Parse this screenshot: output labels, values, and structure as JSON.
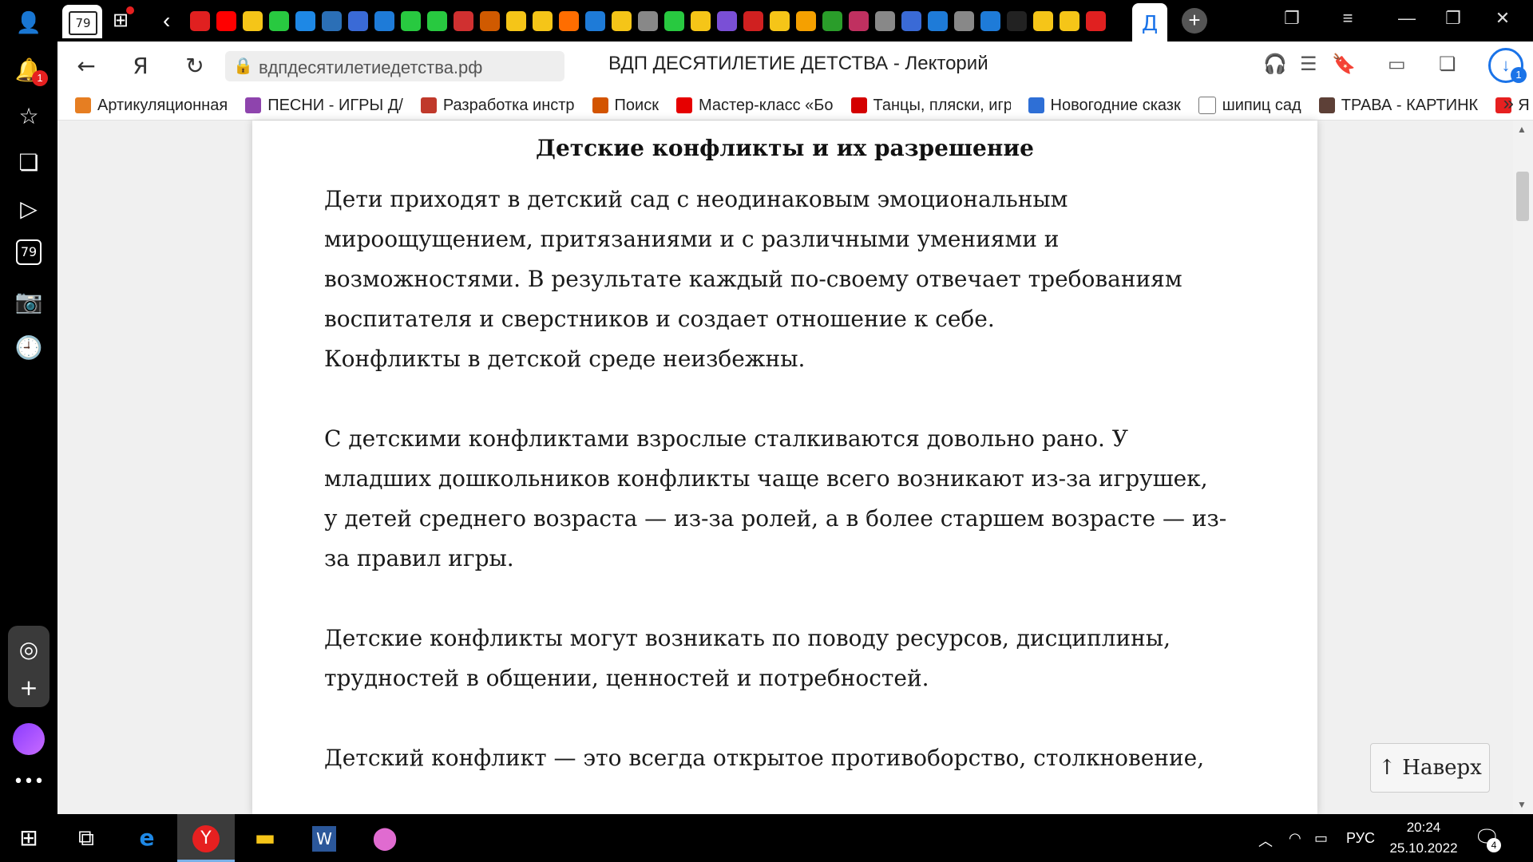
{
  "tabstrip": {
    "home_tab_count": "79",
    "active_tab_letter": "Д",
    "tab_icon_colors": [
      "#e02020",
      "#ff0000",
      "#f5c518",
      "#28c940",
      "#1e88e5",
      "#2b6fb6",
      "#3a6ad6",
      "#1e7bd8",
      "#28c940",
      "#28c940",
      "#d03030",
      "#d05a00",
      "#f5c518",
      "#f5c518",
      "#ff6d00",
      "#1e7bd8",
      "#f5c518",
      "#888888",
      "#28c940",
      "#f5c518",
      "#7a4fd6",
      "#d02020",
      "#f5c518",
      "#f5a000",
      "#2a9d2a",
      "#c03060",
      "#888888",
      "#3a6ad6",
      "#1e7bd8",
      "#888888",
      "#1e7bd8",
      "#222222",
      "#f5c518",
      "#f5c518",
      "#e02020"
    ]
  },
  "navbar": {
    "url": "вдпдесятилетиедетства.рф",
    "title": "ВДП ДЕСЯТИЛЕТИЕ ДЕТСТВА - Лекторий",
    "download_badge": "1"
  },
  "bookmarks": [
    {
      "label": "Артикуляционная",
      "color": "#e67e22"
    },
    {
      "label": "ПЕСНИ - ИГРЫ Д/",
      "color": "#8e44ad"
    },
    {
      "label": "Разработка инстр",
      "color": "#c0392b"
    },
    {
      "label": "Поиск",
      "color": "#d35400"
    },
    {
      "label": "Мастер-класс «Бо",
      "color": "#e60000"
    },
    {
      "label": "Танцы, пляски, игр",
      "color": "#d40000"
    },
    {
      "label": "Новогодние сказк",
      "color": "#2e6fd6"
    },
    {
      "label": "шипиц сад",
      "color": "#ffffff"
    },
    {
      "label": "ТРАВА - КАРТИНК",
      "color": "#5d4037"
    },
    {
      "label": "Я",
      "color": "#e62020"
    }
  ],
  "sidebar": {
    "notification_badge": "1",
    "counter_label": "79"
  },
  "article": {
    "heading": "Детские конфликты и их разрешение",
    "p1_l1": "Дети приходят в детский сад с неодинаковым эмоциональным",
    "p1_l2": "мироощущением, притязаниями и с различными умениями и",
    "p1_l3": "возможностями. В результате каждый по-своему отвечает требованиям",
    "p1_l4": "воспитателя и сверстников и создает отношение к себе.",
    "p1_l5": "Конфликты в детской среде неизбежны.",
    "p2_l1": "С детскими конфликтами взрослые сталкиваются довольно рано. У",
    "p2_l2": "младших дошкольников конфликты чаще всего возникают из-за игрушек,",
    "p2_l3": "у детей среднего возраста — из-за ролей, а в более старшем возрасте — из-",
    "p2_l4": "за правил игры.",
    "p3_l1": "Детские конфликты могут возникать по поводу ресурсов, дисциплины,",
    "p3_l2": "трудностей в общении, ценностей и потребностей.",
    "p4_l1": "Детский конфликт — это всегда открытое противоборство, столкновение,"
  },
  "to_top_label": "↑ Наверх",
  "taskbar": {
    "lang": "РУС",
    "time": "20:24",
    "date": "25.10.2022",
    "notif_count": "4"
  }
}
